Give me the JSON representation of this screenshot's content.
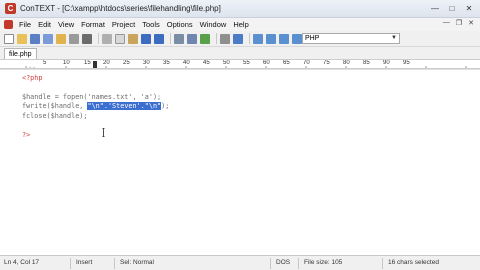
{
  "window": {
    "title": "ConTEXT - [C:\\xampp\\htdocs\\series\\filehandling\\file.php]",
    "app_icon": "C"
  },
  "menu": {
    "items": [
      "File",
      "Edit",
      "View",
      "Format",
      "Project",
      "Tools",
      "Options",
      "Window",
      "Help"
    ]
  },
  "toolbar": {
    "language": "PHP"
  },
  "tabs": [
    {
      "label": "file.php"
    }
  ],
  "ruler": {
    "labels": [
      "5",
      "10",
      "15",
      "20",
      "25",
      "30",
      "35",
      "40",
      "45",
      "50",
      "55",
      "60",
      "65",
      "70",
      "75",
      "80",
      "85",
      "90",
      "95"
    ]
  },
  "editor": {
    "lines": {
      "l1": "<?php",
      "l2": "$handle = fopen('names.txt', 'a');",
      "l3_pre": "fwrite($handle, ",
      "l3_sel": "\"\\n\".'Steven'.\"\\n\"",
      "l3_post": ");",
      "l4": "fclose($handle);",
      "l5": "?>"
    }
  },
  "status": {
    "position": "Ln 4, Col 17",
    "insert": "Insert",
    "selection_mode": "Sel: Normal",
    "line_ending": "DOS",
    "file_size": "File size: 105",
    "selected": "16 chars selected"
  }
}
